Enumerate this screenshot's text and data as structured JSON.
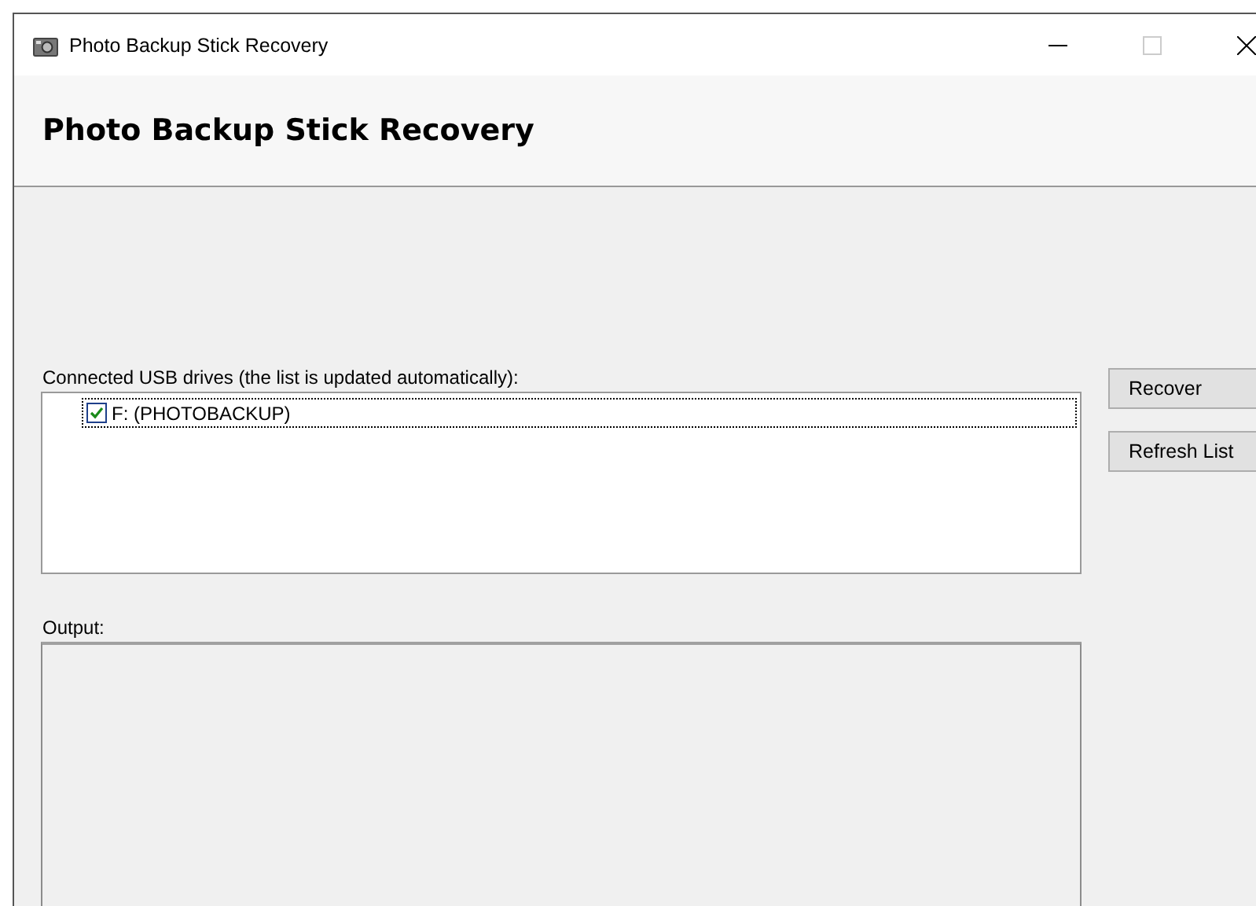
{
  "window": {
    "title": "Photo Backup Stick Recovery"
  },
  "header": {
    "title": "Photo Backup Stick Recovery"
  },
  "drives": {
    "label": "Connected USB drives (the list is updated automatically):",
    "items": [
      {
        "label": "F: (PHOTOBACKUP)",
        "checked": true,
        "selected": true
      }
    ]
  },
  "buttons": [
    "Recover",
    "Refresh List"
  ],
  "output": {
    "label": "Output:"
  }
}
